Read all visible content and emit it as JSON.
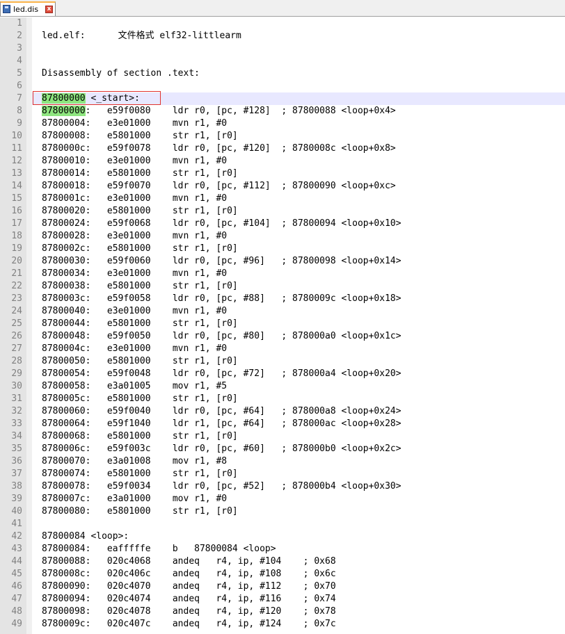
{
  "tab": {
    "label": "led.dis",
    "close_glyph": "x",
    "icon": "save-disk-icon"
  },
  "colors": {
    "current_line_bg": "#e8e8ff",
    "selection_highlight": "#8ee57f",
    "annotation_box": "#e0322e"
  },
  "editor": {
    "lines": [
      {
        "num": "1",
        "pre": "",
        "hl": "",
        "post": ""
      },
      {
        "num": "2",
        "pre": "led.elf:      文件格式 elf32-littlearm",
        "hl": "",
        "post": ""
      },
      {
        "num": "3",
        "pre": "",
        "hl": "",
        "post": ""
      },
      {
        "num": "4",
        "pre": "",
        "hl": "",
        "post": ""
      },
      {
        "num": "5",
        "pre": "Disassembly of section .text:",
        "hl": "",
        "post": ""
      },
      {
        "num": "6",
        "pre": "",
        "hl": "",
        "post": ""
      },
      {
        "num": "7",
        "pre": "",
        "hl": "87800000",
        "post": " <_start>:",
        "current": true
      },
      {
        "num": "8",
        "pre": "",
        "hl": "87800000",
        "post": ":   e59f0080    ldr r0, [pc, #128]  ; 87800088 <loop+0x4>"
      },
      {
        "num": "9",
        "pre": "87800004:   e3e01000    mvn r1, #0",
        "hl": "",
        "post": ""
      },
      {
        "num": "10",
        "pre": "87800008:   e5801000    str r1, [r0]",
        "hl": "",
        "post": ""
      },
      {
        "num": "11",
        "pre": "8780000c:   e59f0078    ldr r0, [pc, #120]  ; 8780008c <loop+0x8>",
        "hl": "",
        "post": ""
      },
      {
        "num": "12",
        "pre": "87800010:   e3e01000    mvn r1, #0",
        "hl": "",
        "post": ""
      },
      {
        "num": "13",
        "pre": "87800014:   e5801000    str r1, [r0]",
        "hl": "",
        "post": ""
      },
      {
        "num": "14",
        "pre": "87800018:   e59f0070    ldr r0, [pc, #112]  ; 87800090 <loop+0xc>",
        "hl": "",
        "post": ""
      },
      {
        "num": "15",
        "pre": "8780001c:   e3e01000    mvn r1, #0",
        "hl": "",
        "post": ""
      },
      {
        "num": "16",
        "pre": "87800020:   e5801000    str r1, [r0]",
        "hl": "",
        "post": ""
      },
      {
        "num": "17",
        "pre": "87800024:   e59f0068    ldr r0, [pc, #104]  ; 87800094 <loop+0x10>",
        "hl": "",
        "post": ""
      },
      {
        "num": "18",
        "pre": "87800028:   e3e01000    mvn r1, #0",
        "hl": "",
        "post": ""
      },
      {
        "num": "19",
        "pre": "8780002c:   e5801000    str r1, [r0]",
        "hl": "",
        "post": ""
      },
      {
        "num": "20",
        "pre": "87800030:   e59f0060    ldr r0, [pc, #96]   ; 87800098 <loop+0x14>",
        "hl": "",
        "post": ""
      },
      {
        "num": "21",
        "pre": "87800034:   e3e01000    mvn r1, #0",
        "hl": "",
        "post": ""
      },
      {
        "num": "22",
        "pre": "87800038:   e5801000    str r1, [r0]",
        "hl": "",
        "post": ""
      },
      {
        "num": "23",
        "pre": "8780003c:   e59f0058    ldr r0, [pc, #88]   ; 8780009c <loop+0x18>",
        "hl": "",
        "post": ""
      },
      {
        "num": "24",
        "pre": "87800040:   e3e01000    mvn r1, #0",
        "hl": "",
        "post": ""
      },
      {
        "num": "25",
        "pre": "87800044:   e5801000    str r1, [r0]",
        "hl": "",
        "post": ""
      },
      {
        "num": "26",
        "pre": "87800048:   e59f0050    ldr r0, [pc, #80]   ; 878000a0 <loop+0x1c>",
        "hl": "",
        "post": ""
      },
      {
        "num": "27",
        "pre": "8780004c:   e3e01000    mvn r1, #0",
        "hl": "",
        "post": ""
      },
      {
        "num": "28",
        "pre": "87800050:   e5801000    str r1, [r0]",
        "hl": "",
        "post": ""
      },
      {
        "num": "29",
        "pre": "87800054:   e59f0048    ldr r0, [pc, #72]   ; 878000a4 <loop+0x20>",
        "hl": "",
        "post": ""
      },
      {
        "num": "30",
        "pre": "87800058:   e3a01005    mov r1, #5",
        "hl": "",
        "post": ""
      },
      {
        "num": "31",
        "pre": "8780005c:   e5801000    str r1, [r0]",
        "hl": "",
        "post": ""
      },
      {
        "num": "32",
        "pre": "87800060:   e59f0040    ldr r0, [pc, #64]   ; 878000a8 <loop+0x24>",
        "hl": "",
        "post": ""
      },
      {
        "num": "33",
        "pre": "87800064:   e59f1040    ldr r1, [pc, #64]   ; 878000ac <loop+0x28>",
        "hl": "",
        "post": ""
      },
      {
        "num": "34",
        "pre": "87800068:   e5801000    str r1, [r0]",
        "hl": "",
        "post": ""
      },
      {
        "num": "35",
        "pre": "8780006c:   e59f003c    ldr r0, [pc, #60]   ; 878000b0 <loop+0x2c>",
        "hl": "",
        "post": ""
      },
      {
        "num": "36",
        "pre": "87800070:   e3a01008    mov r1, #8",
        "hl": "",
        "post": ""
      },
      {
        "num": "37",
        "pre": "87800074:   e5801000    str r1, [r0]",
        "hl": "",
        "post": ""
      },
      {
        "num": "38",
        "pre": "87800078:   e59f0034    ldr r0, [pc, #52]   ; 878000b4 <loop+0x30>",
        "hl": "",
        "post": ""
      },
      {
        "num": "39",
        "pre": "8780007c:   e3a01000    mov r1, #0",
        "hl": "",
        "post": ""
      },
      {
        "num": "40",
        "pre": "87800080:   e5801000    str r1, [r0]",
        "hl": "",
        "post": ""
      },
      {
        "num": "41",
        "pre": "",
        "hl": "",
        "post": ""
      },
      {
        "num": "42",
        "pre": "87800084 <loop>:",
        "hl": "",
        "post": ""
      },
      {
        "num": "43",
        "pre": "87800084:   eafffffe    b   87800084 <loop>",
        "hl": "",
        "post": ""
      },
      {
        "num": "44",
        "pre": "87800088:   020c4068    andeq   r4, ip, #104    ; 0x68",
        "hl": "",
        "post": ""
      },
      {
        "num": "45",
        "pre": "8780008c:   020c406c    andeq   r4, ip, #108    ; 0x6c",
        "hl": "",
        "post": ""
      },
      {
        "num": "46",
        "pre": "87800090:   020c4070    andeq   r4, ip, #112    ; 0x70",
        "hl": "",
        "post": ""
      },
      {
        "num": "47",
        "pre": "87800094:   020c4074    andeq   r4, ip, #116    ; 0x74",
        "hl": "",
        "post": ""
      },
      {
        "num": "48",
        "pre": "87800098:   020c4078    andeq   r4, ip, #120    ; 0x78",
        "hl": "",
        "post": ""
      },
      {
        "num": "49",
        "pre": "8780009c:   020c407c    andeq   r4, ip, #124    ; 0x7c",
        "hl": "",
        "post": ""
      }
    ]
  }
}
